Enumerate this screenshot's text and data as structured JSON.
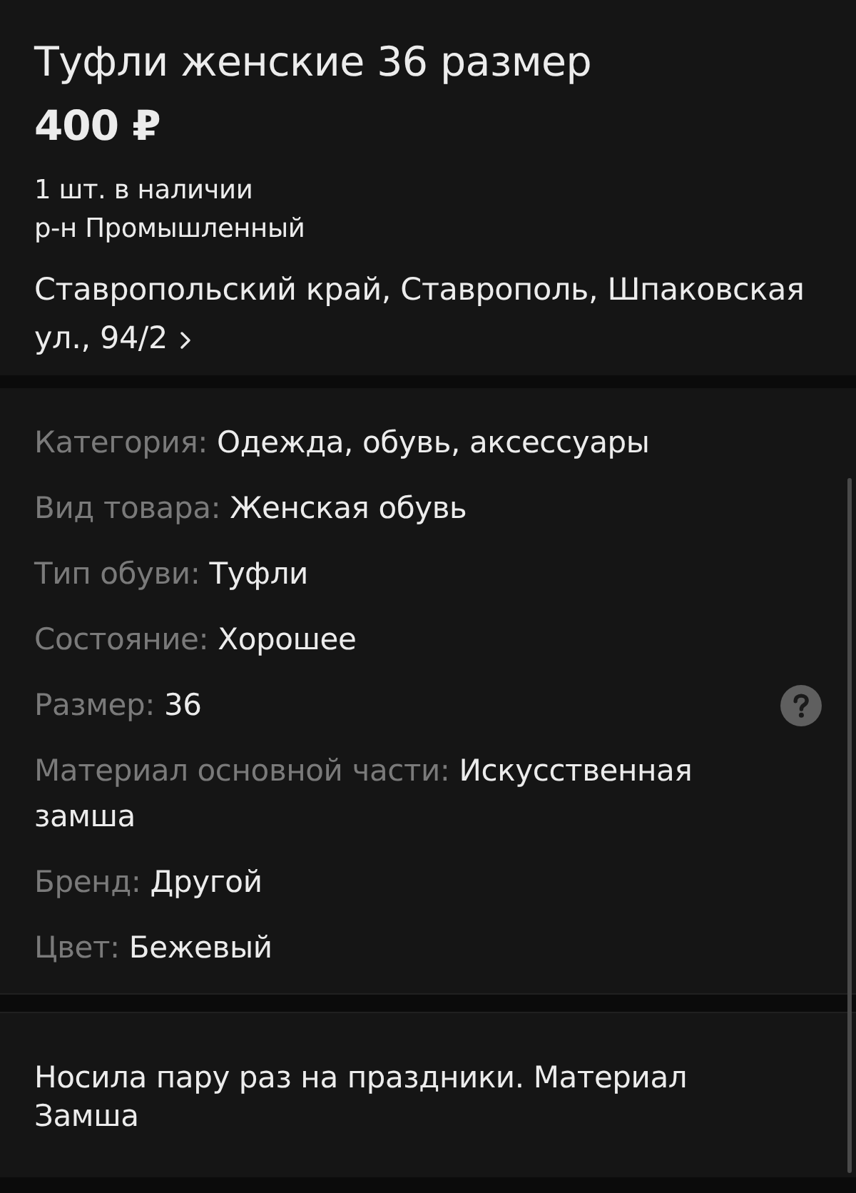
{
  "listing": {
    "title": "Туфли женские 36 размер",
    "price": "400 ₽",
    "stock": "1 шт. в наличии",
    "district": "р-н Промышленный",
    "address": "Ставропольский край, Ставрополь, Шпаковская ул., 94/2"
  },
  "params": [
    {
      "label": "Категория:",
      "value": "Одежда, обувь, аксессуары",
      "help": false
    },
    {
      "label": "Вид товара:",
      "value": "Женская обувь",
      "help": false
    },
    {
      "label": "Тип обуви:",
      "value": "Туфли",
      "help": false
    },
    {
      "label": "Состояние:",
      "value": "Хорошее",
      "help": false
    },
    {
      "label": "Размер:",
      "value": "36",
      "help": true
    },
    {
      "label": "Материал основной части:",
      "value": "Искусственная замша",
      "help": false
    },
    {
      "label": "Бренд:",
      "value": "Другой",
      "help": false
    },
    {
      "label": "Цвет:",
      "value": "Бежевый",
      "help": false
    }
  ],
  "description": {
    "text": "Носила пару раз на праздники. Материал Замша"
  }
}
